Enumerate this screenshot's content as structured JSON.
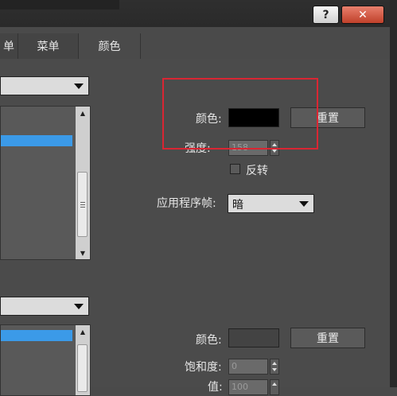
{
  "window": {
    "help_label": "?",
    "close_label": "✕"
  },
  "tabs": [
    {
      "label": "单",
      "selected": false
    },
    {
      "label": "菜单",
      "selected": false
    },
    {
      "label": "颜色",
      "selected": true
    }
  ],
  "upper": {
    "color_label": "颜色:",
    "color_value": "#000000",
    "reset_label": "重置",
    "strength_label": "强度:",
    "strength_value": "158",
    "invert_label": "反转",
    "app_frame_label": "应用程序帧:",
    "app_frame_value": "暗"
  },
  "lower": {
    "color_label": "颜色:",
    "color_value": "#434343",
    "reset_label": "重置",
    "saturation_label": "饱和度:",
    "saturation_value": "0",
    "value_label": "值:",
    "value_value": "100"
  },
  "highlight_color": "#d92633"
}
